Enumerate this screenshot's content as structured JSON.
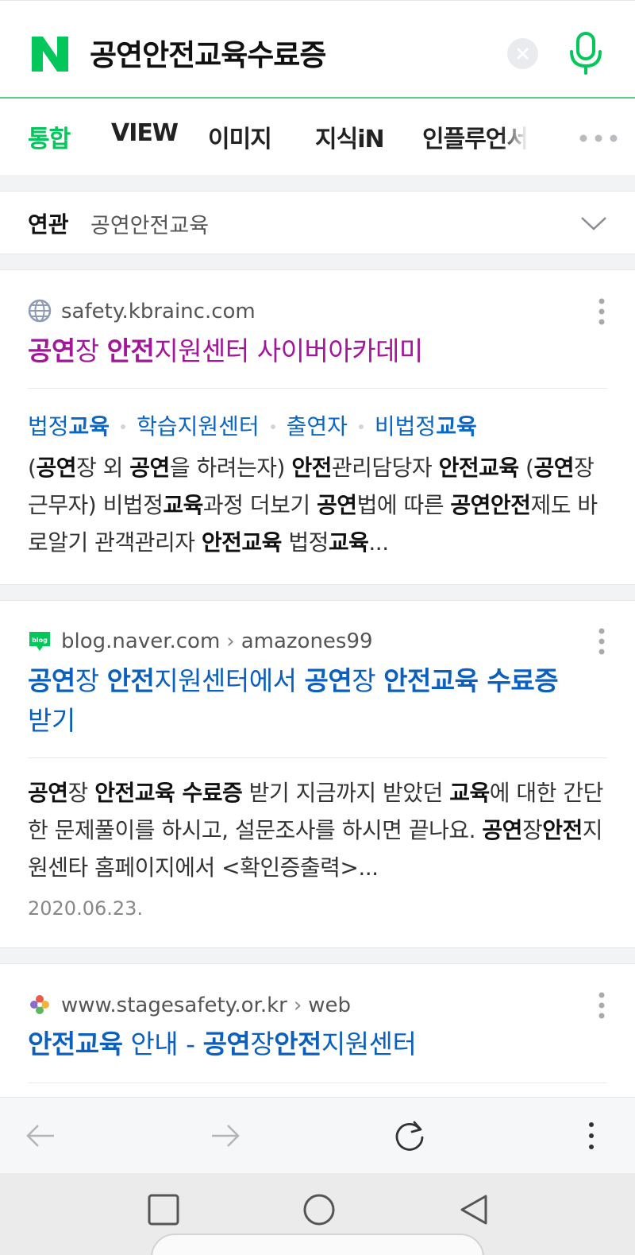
{
  "search": {
    "query": "공연안전교육수료증",
    "logo_letter": "N"
  },
  "tabs": [
    {
      "label": "통합",
      "active": true
    },
    {
      "label": "VIEW",
      "active": false
    },
    {
      "label": "이미지",
      "active": false
    },
    {
      "label": "지식iN",
      "active": false
    },
    {
      "label": "인플루언서",
      "active": false
    }
  ],
  "related": {
    "label": "연관",
    "term": "공연안전교육"
  },
  "results": [
    {
      "source": "safety.kbrainc.com",
      "title_html": "<b>공연</b>장 <b>안전</b>지원센터 사이버아카데미",
      "sublinks": [
        "법정교육",
        "학습지원센터",
        "출연자",
        "비법정교육"
      ],
      "description": "(공연장 외 공연을 하려는자) 안전관리담당자 안전교육 (공연장 근무자) 비법정교육과정 더보기 공연법에 따른 공연안전제도 바로알기 관객관리자 안전교육 법정교육..."
    },
    {
      "source": "blog.naver.com",
      "source_path": "amazones99",
      "title": "공연장 안전지원센터에서 공연장 안전교육 수료증 받기",
      "description": "공연장 안전교육 수료증 받기 지금까지 받았던 교육에 대한 간단한 문제풀이를 하시고, 설문조사를 하시면 끝나요. 공연장안전지원센타 홈페이지에서 <확인증출력>...",
      "date": "2020.06.23."
    },
    {
      "source": "www.stagesafety.or.kr",
      "source_path": "web",
      "title": "안전교육 안내 - 공연장안전지원센터"
    }
  ],
  "colors": {
    "naver_green": "#03c75a",
    "visited_link": "#a3159a",
    "link_blue": "#0b5fbf"
  }
}
